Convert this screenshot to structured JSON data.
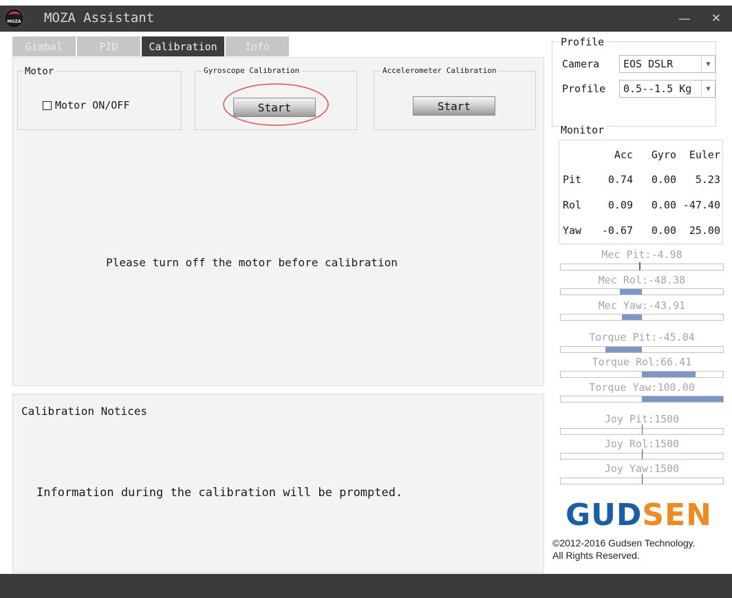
{
  "window": {
    "title": "MOZA Assistant",
    "logo_text": "MOZA"
  },
  "tabs": [
    {
      "label": "Gimbal",
      "active": false
    },
    {
      "label": "PID",
      "active": false
    },
    {
      "label": "Calibration",
      "active": true
    },
    {
      "label": "Info",
      "active": false
    }
  ],
  "motor": {
    "legend": "Motor",
    "checkbox_label": "Motor ON/OFF",
    "checked": false
  },
  "gyro": {
    "legend": "Gyroscope Calibration",
    "button_label": "Start"
  },
  "accel": {
    "legend": "Accelerometer Calibration",
    "button_label": "Start"
  },
  "main": {
    "message": "Please turn off the motor before calibration"
  },
  "notices": {
    "title": "Calibration Notices",
    "info": "Information during the calibration will be prompted."
  },
  "profile": {
    "legend": "Profile",
    "camera_label": "Camera",
    "camera_value": "EOS DSLR",
    "profile_label": "Profile",
    "profile_value": "0.5--1.5 Kg"
  },
  "monitor": {
    "legend": "Monitor",
    "headers": [
      "Acc",
      "Gyro",
      "Euler"
    ],
    "rows": [
      {
        "name": "Pit",
        "acc": "0.74",
        "gyro": "0.00",
        "euler": "5.23"
      },
      {
        "name": "Rol",
        "acc": "0.09",
        "gyro": "0.00",
        "euler": "-47.40"
      },
      {
        "name": "Yaw",
        "acc": "-0.67",
        "gyro": "0.00",
        "euler": "25.00"
      }
    ],
    "bars": [
      {
        "label": "Mec Pit:-4.98",
        "kind": "mark",
        "value": -4.98,
        "scale": 180
      },
      {
        "label": "Mec Rol:-48.38",
        "kind": "fill",
        "value": -48.38,
        "scale": 180
      },
      {
        "label": "Mec Yaw:-43.91",
        "kind": "fill",
        "value": -43.91,
        "scale": 180
      },
      {
        "label": "Torque Pit:-45.04",
        "kind": "fill",
        "value": -45.04,
        "scale": 100
      },
      {
        "label": "Torque Rol:66.41",
        "kind": "fill",
        "value": 66.41,
        "scale": 100
      },
      {
        "label": "Torque Yaw:100.00",
        "kind": "fill",
        "value": 100.0,
        "scale": 100
      },
      {
        "label": "Joy Pit:1500",
        "kind": "center",
        "value": 0,
        "scale": 500
      },
      {
        "label": "Joy Rol:1500",
        "kind": "center",
        "value": 0,
        "scale": 500
      },
      {
        "label": "Joy Yaw:1500",
        "kind": "center",
        "value": 0,
        "scale": 500
      }
    ]
  },
  "brand": {
    "part1": "GUD",
    "part2": "SEN"
  },
  "copyright": {
    "line1": "©2012-2016 Gudsen Technology.",
    "line2": "All Rights Reserved."
  },
  "colors": {
    "titlebar": "#3b3b3b",
    "tab_active": "#3c3c3c",
    "tab_inactive": "#c6c6c6",
    "bar_fill": "#7b97c8",
    "brand_blue": "#1b5ea8",
    "brand_orange": "#f0891f",
    "highlight_circle": "#e05050"
  }
}
